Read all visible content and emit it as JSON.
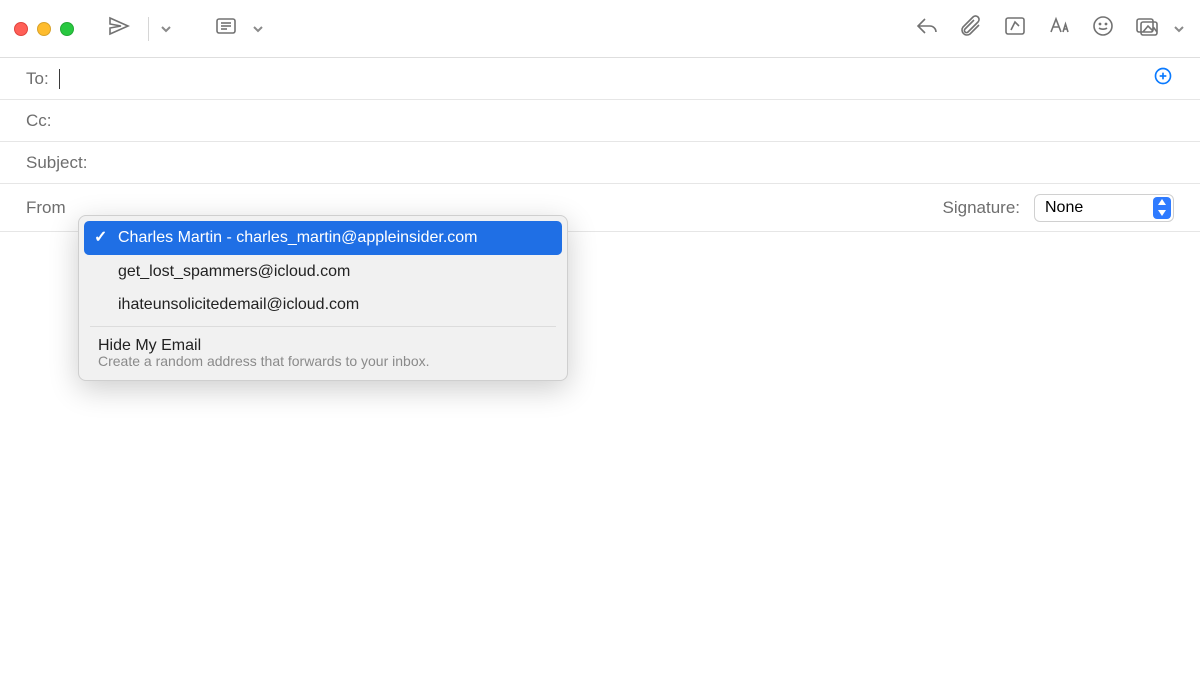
{
  "fields": {
    "to_label": "To:",
    "cc_label": "Cc:",
    "subject_label": "Subject:",
    "from_label": "From",
    "to_value": "",
    "cc_value": "",
    "subject_value": ""
  },
  "signature": {
    "label": "Signature:",
    "selected": "None"
  },
  "from_dropdown": {
    "options": [
      "Charles Martin - charles_martin@appleinsider.com",
      "get_lost_spammers@icloud.com",
      "ihateunsolicitedemail@icloud.com"
    ],
    "selected_index": 0,
    "hide_my_email": {
      "title": "Hide My Email",
      "subtitle": "Create a random address that forwards to your inbox."
    }
  },
  "icons": {
    "send": "send-icon",
    "header_panel": "list-icon",
    "reply": "reply-icon",
    "attach": "paperclip-icon",
    "markup": "markup-icon",
    "font": "font-icon",
    "emoji": "emoji-icon",
    "photo": "photo-icon"
  },
  "colors": {
    "accent": "#1f6fe5",
    "link": "#0a7aff"
  }
}
